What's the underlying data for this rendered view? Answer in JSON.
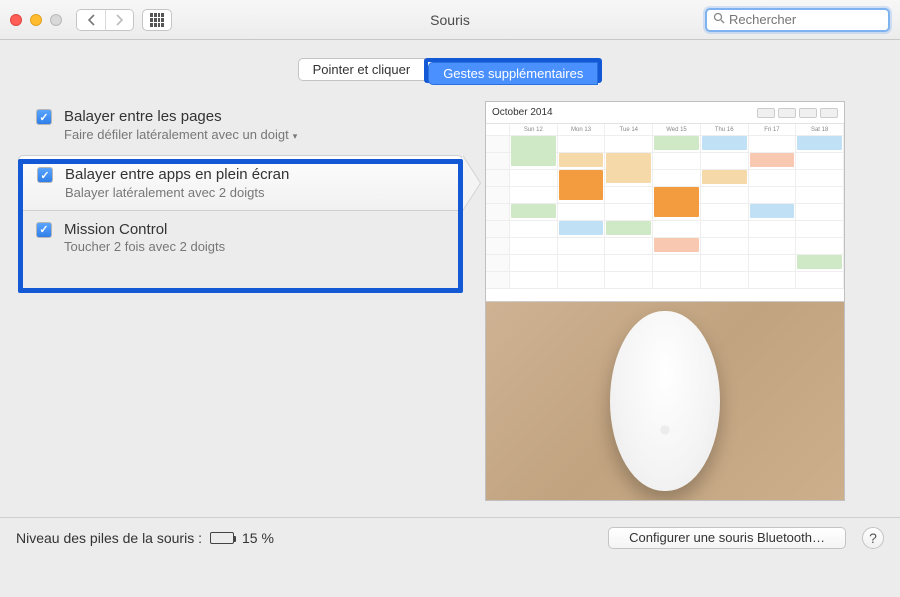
{
  "window": {
    "title": "Souris"
  },
  "search": {
    "placeholder": "Rechercher"
  },
  "tabs": {
    "pointer": "Pointer et cliquer",
    "gestures": "Gestes supplémentaires",
    "active": "gestures"
  },
  "options": [
    {
      "checked": true,
      "title": "Balayer entre les pages",
      "subtitle": "Faire défiler latéralement avec un doigt",
      "has_dropdown": true
    },
    {
      "checked": true,
      "title": "Balayer entre apps en plein écran",
      "subtitle": "Balayer latéralement avec 2 doigts",
      "has_dropdown": false,
      "selected": true
    },
    {
      "checked": true,
      "title": "Mission Control",
      "subtitle": "Toucher 2 fois avec 2 doigts",
      "has_dropdown": false
    }
  ],
  "preview": {
    "calendar_title": "October 2014",
    "day_headers": [
      "",
      "Sun 12",
      "Mon 13",
      "Tue 14",
      "Wed 15",
      "Thu 16",
      "Fri 17",
      "Sat 18"
    ]
  },
  "footer": {
    "battery_label": "Niveau des piles de la souris :",
    "battery_pct": "15 %",
    "bluetooth_button": "Configurer une souris Bluetooth…"
  },
  "colors": {
    "highlight": "#1359d5",
    "accent": "#4a90ff"
  }
}
